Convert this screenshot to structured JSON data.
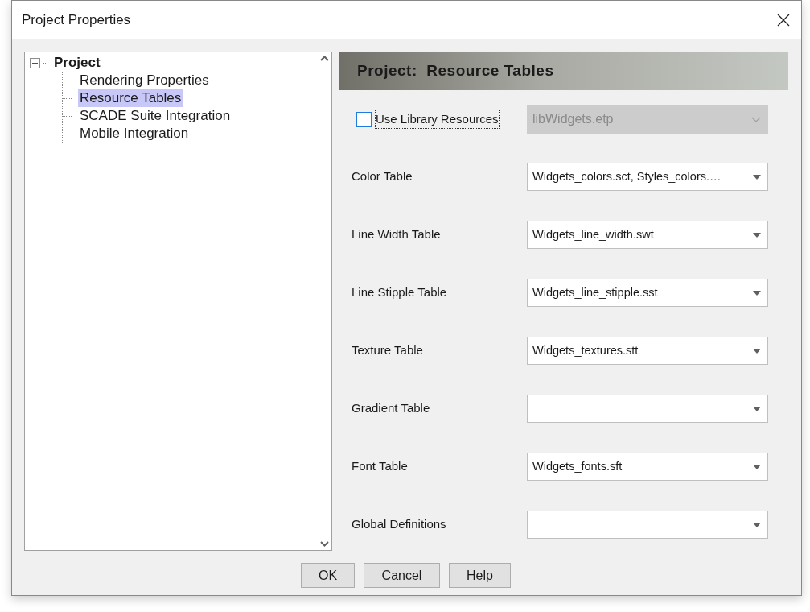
{
  "window": {
    "title": "Project Properties"
  },
  "tree": [
    {
      "label": "Project",
      "expanded": true,
      "selected": false,
      "children": [
        {
          "label": "Rendering Properties",
          "selected": false
        },
        {
          "label": "Resource Tables",
          "selected": true
        },
        {
          "label": "SCADE Suite Integration",
          "selected": false
        },
        {
          "label": "Mobile Integration",
          "selected": false
        }
      ]
    }
  ],
  "panel": {
    "title": "Project:  Resource Tables"
  },
  "library": {
    "label": "Use Library Resources",
    "checked": false,
    "value": "libWidgets.etp",
    "disabled": true
  },
  "tables": [
    {
      "label": "Color Table",
      "value": "Widgets_colors.sct, Styles_colors.…"
    },
    {
      "label": "Line Width Table",
      "value": "Widgets_line_width.swt"
    },
    {
      "label": "Line Stipple Table",
      "value": "Widgets_line_stipple.sst"
    },
    {
      "label": "Texture Table",
      "value": "Widgets_textures.stt"
    },
    {
      "label": "Gradient Table"
    },
    {
      "label": "Font Table",
      "value": "Widgets_fonts.sft"
    },
    {
      "label": "Global Definitions"
    }
  ],
  "buttons": [
    "OK",
    "Cancel",
    "Help"
  ]
}
